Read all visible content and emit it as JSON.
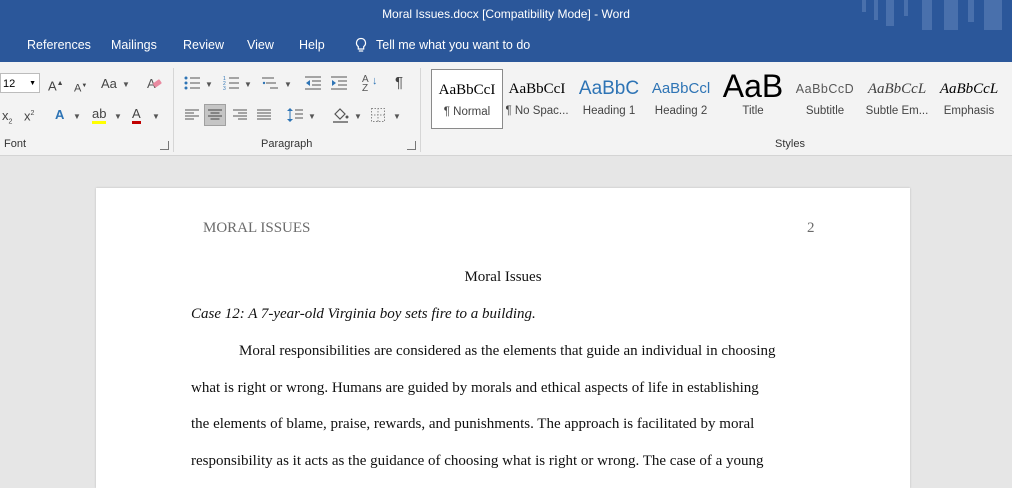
{
  "window": {
    "title": "Moral Issues.docx [Compatibility Mode]  -  Word"
  },
  "menu": {
    "tabs": [
      "References",
      "Mailings",
      "Review",
      "View",
      "Help"
    ],
    "tell_me": "Tell me what you want to do"
  },
  "ribbon": {
    "font_size": "12",
    "groups": {
      "font": "Font",
      "paragraph": "Paragraph",
      "styles": "Styles"
    },
    "styles": [
      {
        "preview": "AaBbCcI",
        "name": "¶ Normal",
        "color": "#000000"
      },
      {
        "preview": "AaBbCcI",
        "name": "¶ No Spac...",
        "color": "#000000"
      },
      {
        "preview": "AaBbC",
        "name": "Heading 1",
        "color": "#2e74b5"
      },
      {
        "preview": "AaBbCcl",
        "name": "Heading 2",
        "color": "#2e74b5"
      },
      {
        "preview": "AaB",
        "name": "Title",
        "color": "#000000"
      },
      {
        "preview": "AaBbCcD",
        "name": "Subtitle",
        "color": "#595959"
      },
      {
        "preview": "AaBbCcL",
        "name": "Subtle Em...",
        "color": "#404040"
      },
      {
        "preview": "AaBbCcL",
        "name": "Emphasis",
        "color": "#000000"
      }
    ],
    "icons": [
      "grow-font-icon",
      "shrink-font-icon",
      "change-case-icon",
      "clear-formatting-icon",
      "subscript-icon",
      "superscript-icon",
      "text-effects-icon",
      "highlight-icon",
      "font-color-icon",
      "bullets-icon",
      "numbering-icon",
      "multilevel-list-icon",
      "decrease-indent-icon",
      "increase-indent-icon",
      "sort-icon",
      "pilcrow-icon",
      "align-left-icon",
      "align-center-icon",
      "align-right-icon",
      "justify-icon",
      "line-spacing-icon",
      "shading-icon",
      "borders-icon"
    ],
    "colors": {
      "highlight": "#ffff00",
      "font_color": "#c00000"
    }
  },
  "document": {
    "header_left": "MORAL ISSUES",
    "page_number": "2",
    "title": "Moral Issues",
    "case": "Case 12: A 7-year-old Virginia boy sets fire to a building.",
    "lines": [
      "Moral responsibilities are considered as the elements that guide an individual in choosing",
      "what is right or wrong. Humans are guided by morals and ethical aspects of life in establishing",
      "the elements of blame, praise, rewards, and punishments. The approach is facilitated by moral",
      "responsibility as it acts as the guidance of choosing what is right or wrong. The case of a young"
    ]
  },
  "theme": {
    "accent": "#2b579a",
    "ribbon_bg": "#f3f3f3",
    "canvas_bg": "#e6e6e6"
  }
}
